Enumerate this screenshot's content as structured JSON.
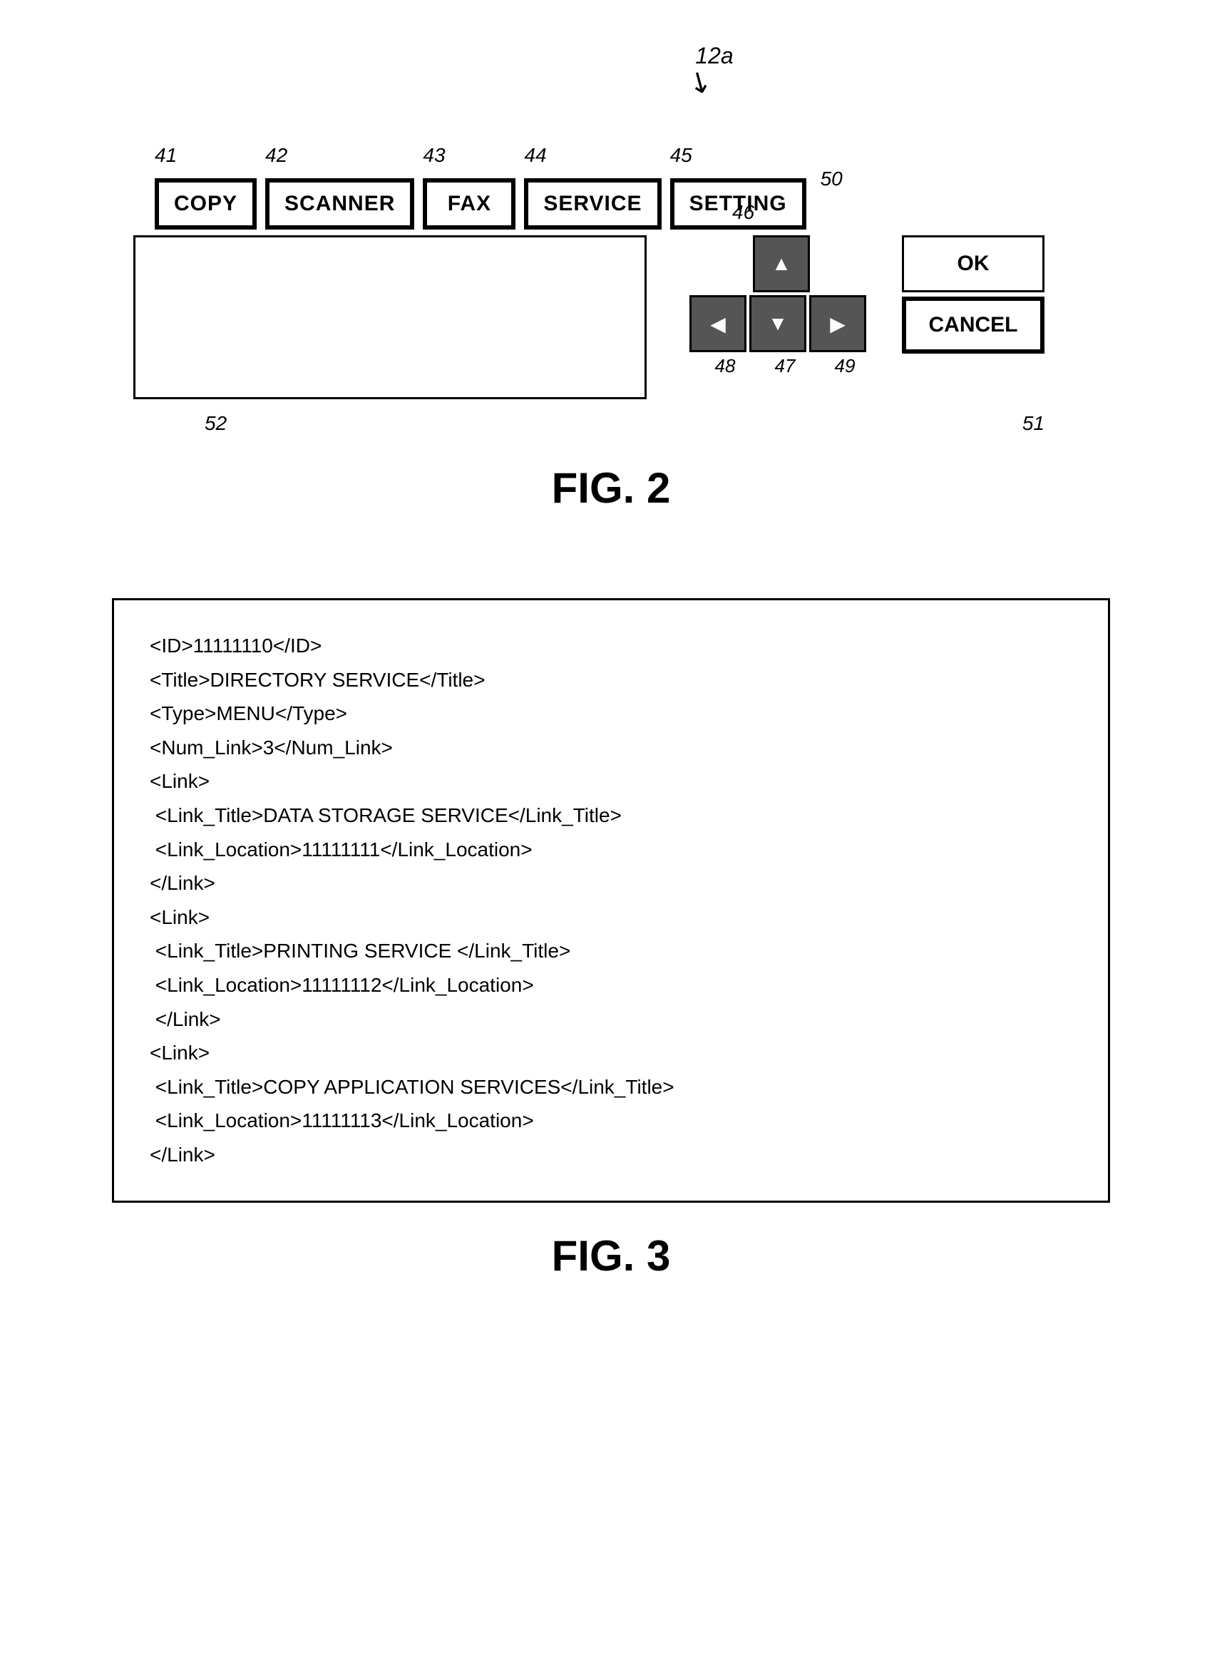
{
  "fig2": {
    "label_12a": "12a",
    "tabs": [
      {
        "id": "41",
        "label": "COPY"
      },
      {
        "id": "42",
        "label": "SCANNER"
      },
      {
        "id": "43",
        "label": "FAX"
      },
      {
        "id": "44",
        "label": "SERVICE"
      },
      {
        "id": "45",
        "label": "SETTING"
      }
    ],
    "label_50": "50",
    "label_52": "52",
    "label_46": "46",
    "label_48": "48",
    "label_47": "47",
    "label_49": "49",
    "label_51": "51",
    "nav_up": "▲",
    "nav_down": "▼",
    "nav_left": "◀",
    "nav_right": "▶",
    "btn_ok": "OK",
    "btn_cancel": "CANCEL",
    "caption": "FIG. 2"
  },
  "fig3": {
    "caption": "FIG. 3",
    "lines": [
      "<ID>11111110</ID>",
      "<Title>DIRECTORY SERVICE</Title>",
      "<Type>MENU</Type>",
      "<Num_Link>3</Num_Link>",
      "<Link>",
      " <Link_Title>DATA STORAGE SERVICE</Link_Title>",
      " <Link_Location>11111111</Link_Location>",
      "</Link>",
      "<Link>",
      " <Link_Title>PRINTING SERVICE </Link_Title>",
      " <Link_Location>11111112</Link_Location>",
      " </Link>",
      "<Link>",
      " <Link_Title>COPY APPLICATION SERVICES</Link_Title>",
      " <Link_Location>11111113</Link_Location>",
      "</Link>"
    ]
  }
}
